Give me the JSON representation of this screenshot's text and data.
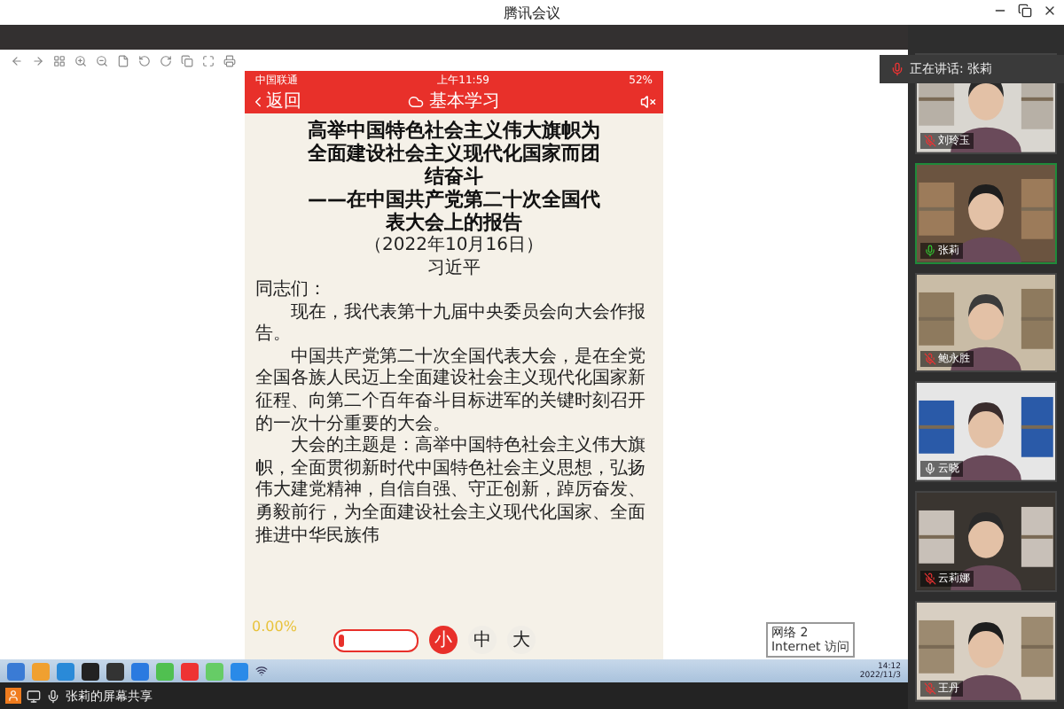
{
  "window": {
    "title": "腾讯会议"
  },
  "speaker_banner": {
    "text": "正在讲话: 张莉"
  },
  "phone": {
    "carrier": "中国联通",
    "time": "上午11:59",
    "battery": "52%",
    "back": "返回",
    "app_title": "基本学习",
    "title_lines": [
      "高举中国特色社会主义伟大旗帜为",
      "全面建设社会主义现代化国家而团",
      "结奋斗",
      "——在中国共产党第二十次全国代",
      "表大会上的报告"
    ],
    "date": "（2022年10月16日）",
    "author": "习近平",
    "paragraphs": [
      {
        "indent": false,
        "lines": [
          "同志们："
        ]
      },
      {
        "indent": true,
        "lines": [
          "现在，我代表第十九届中央委员会向大会作报",
          "告。"
        ]
      },
      {
        "indent": true,
        "lines": [
          "中国共产党第二十次全国代表大会，是在全党",
          "全国各族人民迈上全面建设社会主义现代化国家新",
          "征程、向第二个百年奋斗目标进军的关键时刻召开",
          "的一次十分重要的大会。"
        ]
      },
      {
        "indent": true,
        "lines": [
          "大会的主题是：高举中国特色社会主义伟大旗",
          "帜，全面贯彻新时代中国特色社会主义思想，弘扬",
          "伟大建党精神，自信自强、守正创新，踔厉奋发、",
          "勇毅前行，为全面建设社会主义现代化国家、全面",
          "推进中华民族伟"
        ]
      }
    ],
    "progress": "0.00%",
    "font_sizes": [
      {
        "label": "小",
        "selected": true
      },
      {
        "label": "中",
        "selected": false
      },
      {
        "label": "大",
        "selected": false
      }
    ]
  },
  "participants": [
    {
      "name": "刘玲玉",
      "muted": true,
      "speaking": false,
      "kind": "picture"
    },
    {
      "name": "张莉",
      "muted": false,
      "speaking": true,
      "kind": "picture"
    },
    {
      "name": "鲍永胜",
      "muted": true,
      "speaking": false,
      "kind": "picture"
    },
    {
      "name": "云晓",
      "muted": false,
      "speaking": false,
      "kind": "picture"
    },
    {
      "name": "云莉娜",
      "muted": true,
      "speaking": false,
      "kind": "picture"
    },
    {
      "name": "王丹",
      "muted": true,
      "speaking": false,
      "kind": "picture"
    }
  ],
  "taskbar": {
    "tooltip_lines": [
      "网络 2",
      "Internet 访问"
    ],
    "time": "14:12",
    "date": "2022/11/3"
  },
  "share_bar": {
    "text": "张莉的屏幕共享"
  }
}
